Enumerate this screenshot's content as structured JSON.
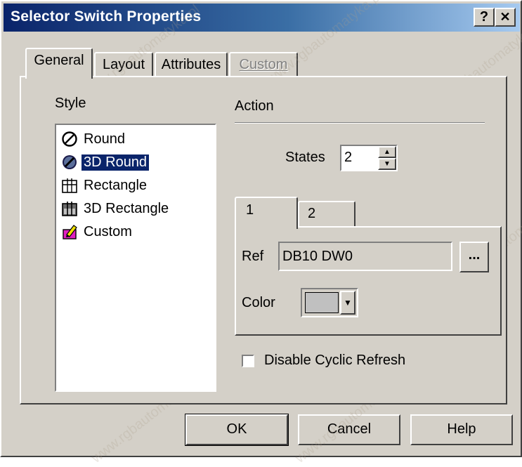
{
  "window": {
    "title": "Selector Switch Properties",
    "help_button": "?",
    "close_button": "✕"
  },
  "tabs": [
    {
      "label": "General",
      "active": true
    },
    {
      "label": "Layout",
      "active": false
    },
    {
      "label": "Attributes",
      "active": false
    },
    {
      "label": "Custom",
      "active": false,
      "disabled": true
    }
  ],
  "style_group": {
    "label": "Style",
    "items": [
      {
        "label": "Round",
        "icon": "round-icon",
        "selected": false
      },
      {
        "label": "3D Round",
        "icon": "3d-round-icon",
        "selected": true
      },
      {
        "label": "Rectangle",
        "icon": "rectangle-icon",
        "selected": false
      },
      {
        "label": "3D Rectangle",
        "icon": "3d-rectangle-icon",
        "selected": false
      },
      {
        "label": "Custom",
        "icon": "custom-icon",
        "selected": false
      }
    ]
  },
  "action": {
    "label": "Action",
    "states_label": "States",
    "states_value": "2",
    "state_tabs": [
      {
        "label": "1",
        "active": true
      },
      {
        "label": "2",
        "active": false
      }
    ],
    "ref_label": "Ref",
    "ref_value": "DB10 DW0",
    "browse_label": "...",
    "color_label": "Color",
    "color_value": "#c0c0c0",
    "disable_refresh_label": "Disable Cyclic Refresh",
    "disable_refresh_checked": false
  },
  "buttons": {
    "ok": "OK",
    "cancel": "Cancel",
    "help": "Help"
  },
  "watermark": "www.rgbautomatyka.pl"
}
